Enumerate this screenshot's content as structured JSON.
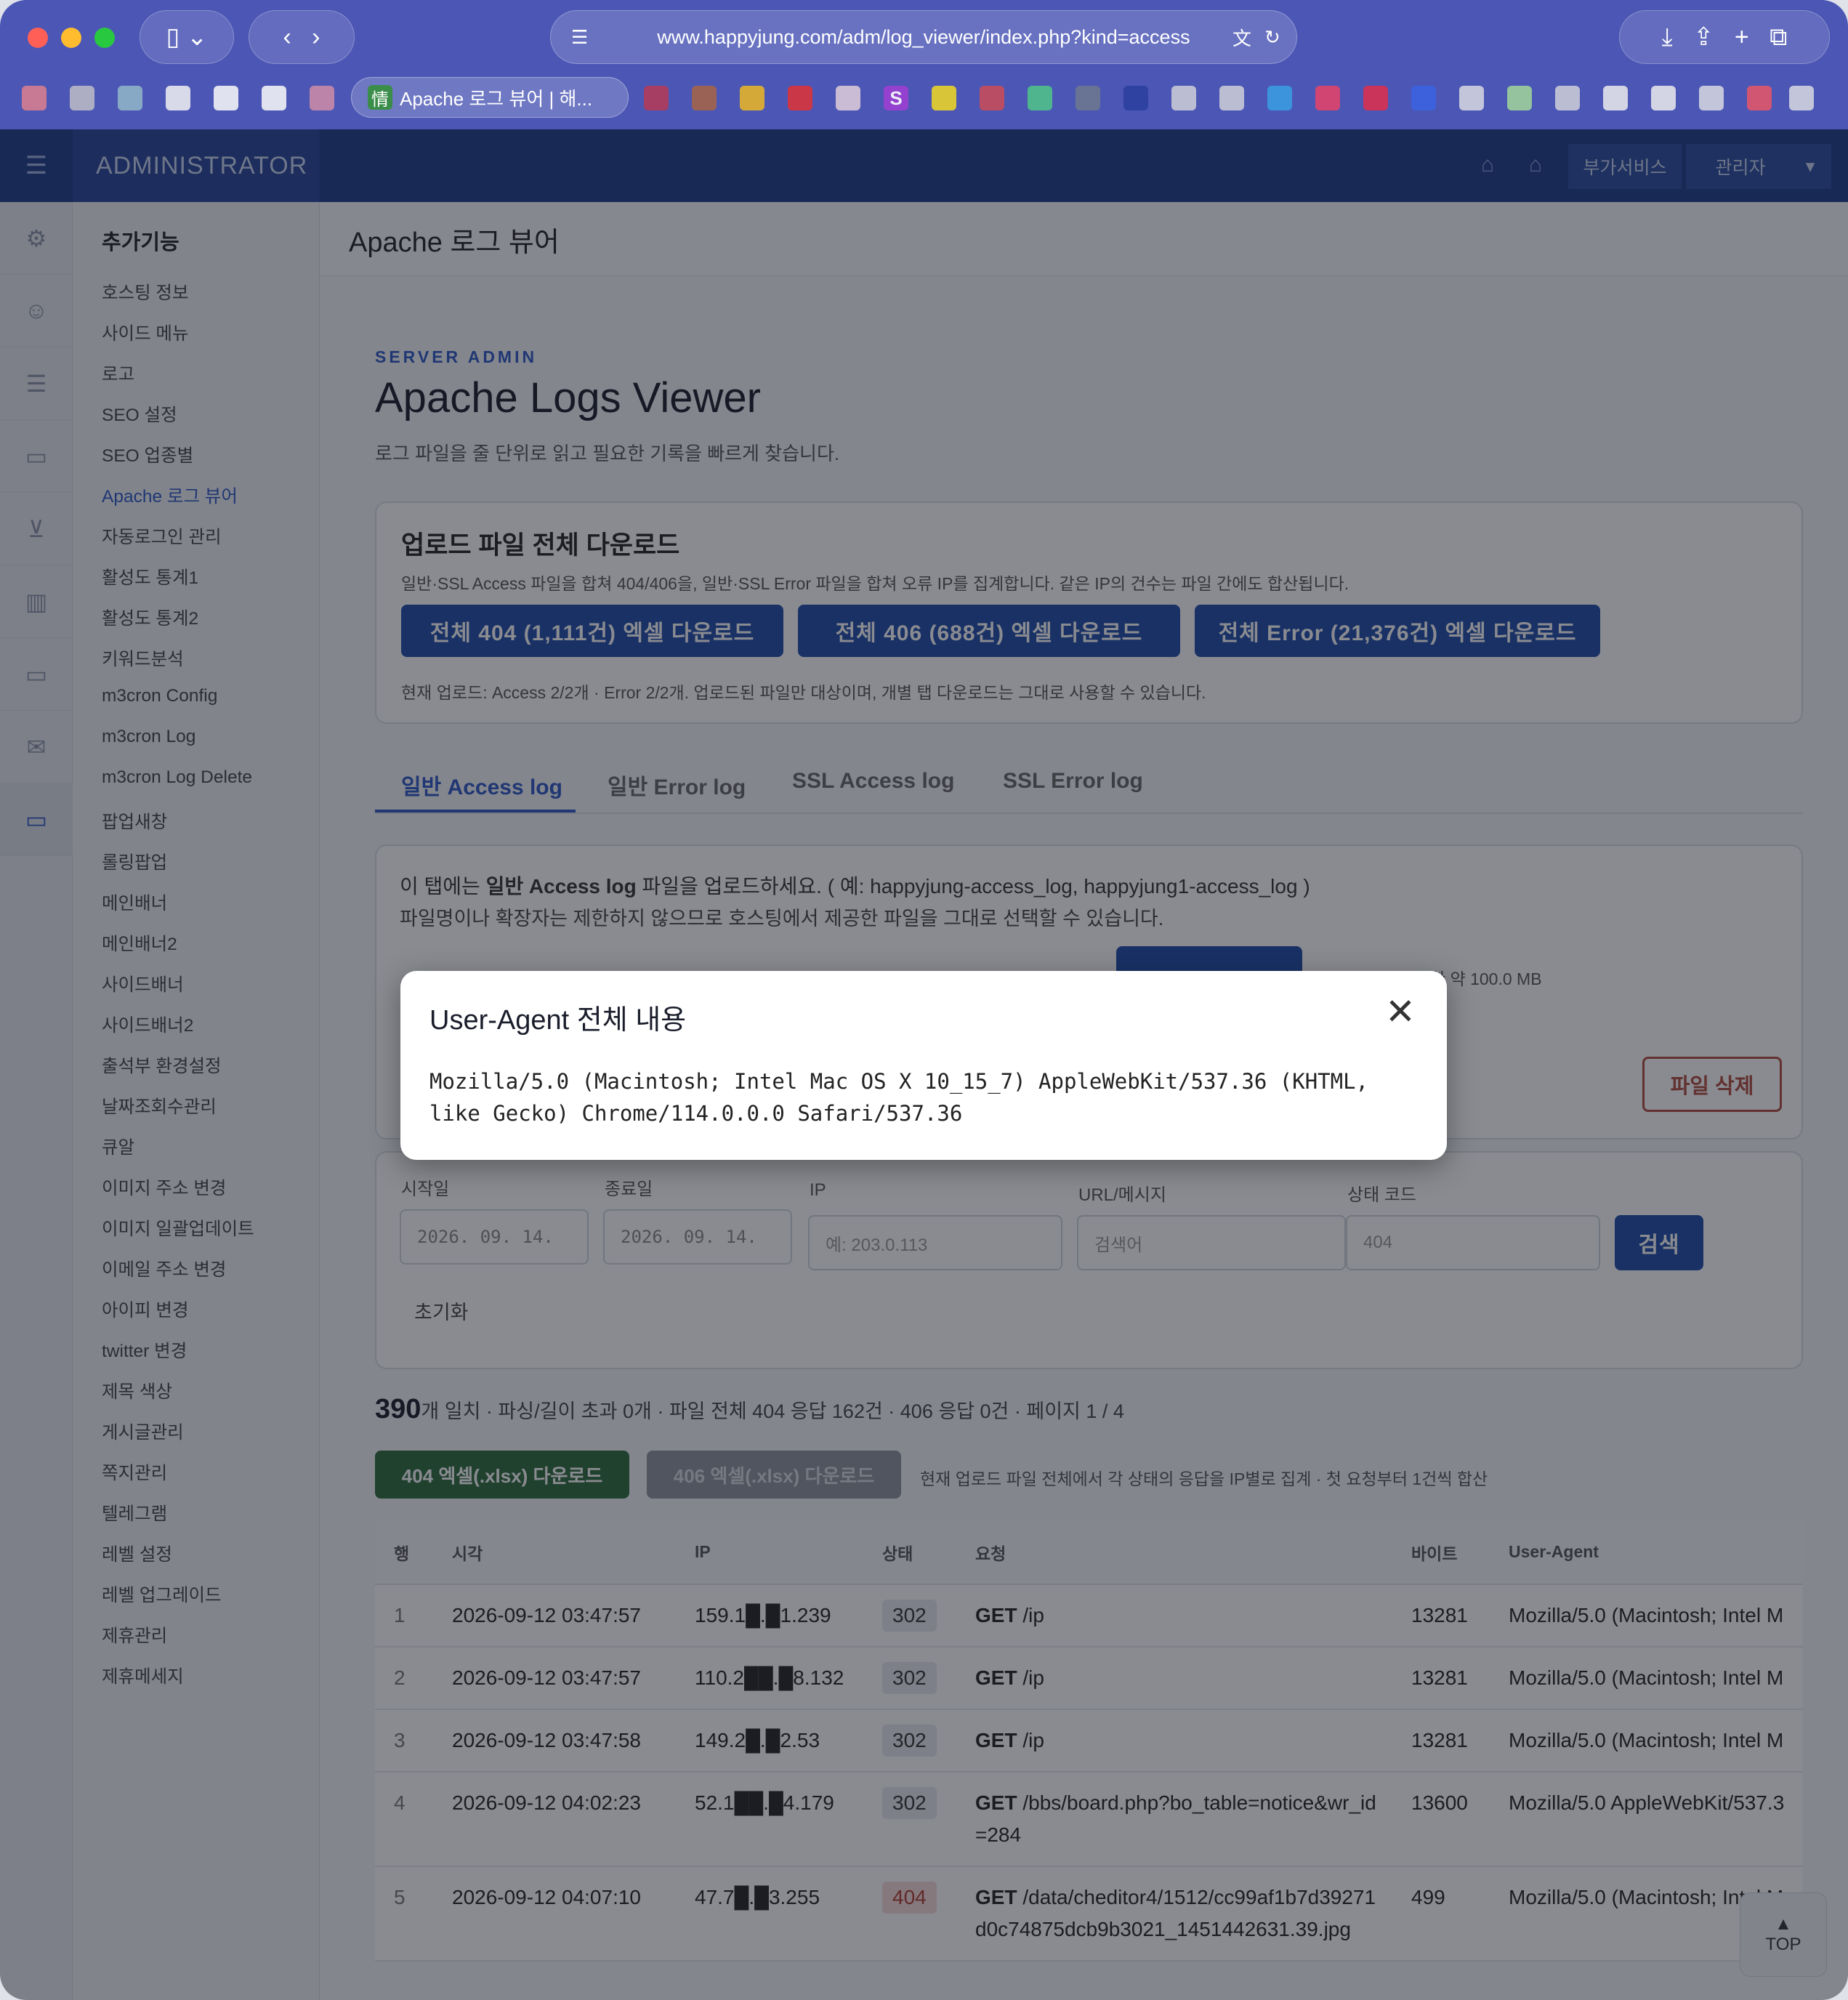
{
  "browser": {
    "url": "www.happyjung.com/adm/log_viewer/index.php?kind=access",
    "active_tab": "Apache 로그 뷰어 | 해...",
    "active_tab_icon": "情"
  },
  "header": {
    "brand": "ADMINISTRATOR",
    "extra_services": "부가서비스",
    "admin": "관리자"
  },
  "sidebar": {
    "title": "추가기능",
    "items": [
      "호스팅 정보",
      "사이드 메뉴",
      "로고",
      "SEO 설정",
      "SEO 업종별",
      "Apache 로그 뷰어",
      "자동로그인 관리",
      "활성도 통계1",
      "활성도 통계2",
      "키워드분석",
      "m3cron Config",
      "m3cron Log",
      "m3cron Log Delete",
      "팝업새창",
      "롤링팝업",
      "메인배너",
      "메인배너2",
      "사이드배너",
      "사이드배너2",
      "출석부 환경설정",
      "날짜조회수관리",
      "큐알",
      "이미지 주소 변경",
      "이미지 일괄업데이트",
      "이메일 주소 변경",
      "아이피 변경",
      "twitter 변경",
      "제목 색상",
      "게시글관리",
      "쪽지관리",
      "텔레그램",
      "레벨 설정",
      "레벨 업그레이드",
      "제휴관리",
      "제휴메세지"
    ],
    "active_index": 5
  },
  "page": {
    "breadcrumb": "Apache 로그 뷰어",
    "eyebrow": "SERVER ADMIN",
    "title": "Apache Logs Viewer",
    "lead": "로그 파일을 줄 단위로 읽고 필요한 기록을 빠르게 찾습니다."
  },
  "download_card": {
    "title": "업로드 파일 전체 다운로드",
    "desc": "일반·SSL Access 파일을 합쳐 404/406을, 일반·SSL Error 파일을 합쳐 오류 IP를 집계합니다. 같은 IP의 건수는 파일 간에도 합산됩니다.",
    "btn_404": "전체 404 (1,111건) 엑셀 다운로드",
    "btn_406": "전체 406 (688건) 엑셀 다운로드",
    "btn_error": "전체 Error (21,376건) 엑셀 다운로드",
    "note": "현재 업로드: Access 2/2개 · Error 2/2개. 업로드된 파일만 대상이며, 개별 탭 다운로드는 그대로 사용할 수 있습니다."
  },
  "tabs": [
    "일반 Access log",
    "일반 Error log",
    "SSL Access log",
    "SSL Error log"
  ],
  "upload": {
    "line1_prefix": "이 탭에는 ",
    "line1_bold": "일반 Access log",
    "line1_suffix": " 파일을 업로드하세요. ( 예: happyjung-access_log, happyjung1-access_log )",
    "line2": "파일명이나 확장자는 제한하지 않으므로 호스팅에서 제공한 파일을 그대로 선택할 수 있습니다.",
    "limit": "한 약 100.0 MB",
    "delete_btn": "파일 삭제"
  },
  "filters": {
    "start_label": "시작일",
    "start_value": "2026. 09. 14.",
    "end_label": "종료일",
    "end_value": "2026. 09. 14.",
    "ip_label": "IP",
    "ip_placeholder": "예: 203.0.113",
    "url_label": "URL/메시지",
    "url_placeholder": "검색어",
    "status_label": "상태 코드",
    "status_placeholder": "404",
    "search_btn": "검색",
    "reset": "초기화"
  },
  "summary": {
    "count": "390",
    "text": "개 일치 · 파싱/길이 초과 0개 · 파일 전체 404 응답 162건 · 406 응답 0건 · 페이지 1 / 4"
  },
  "excel": {
    "btn_404": "404 엑셀(.xlsx) 다운로드",
    "btn_406": "406 엑셀(.xlsx) 다운로드",
    "note": "현재 업로드 파일 전체에서 각 상태의 응답을 IP별로 집계 · 첫 요청부터 1건씩 합산"
  },
  "table": {
    "headers": [
      "행",
      "시각",
      "IP",
      "상태",
      "요청",
      "바이트",
      "User-Agent"
    ],
    "rows": [
      {
        "n": "1",
        "time": "2026-09-12 03:47:57",
        "ip": "159.1█.█1.239",
        "status": "302",
        "method": "GET",
        "path": "/ip",
        "bytes": "13281",
        "ua": "Mozilla/5.0 (Macintosh; Intel M"
      },
      {
        "n": "2",
        "time": "2026-09-12 03:47:57",
        "ip": "110.2██.█8.132",
        "status": "302",
        "method": "GET",
        "path": "/ip",
        "bytes": "13281",
        "ua": "Mozilla/5.0 (Macintosh; Intel M"
      },
      {
        "n": "3",
        "time": "2026-09-12 03:47:58",
        "ip": "149.2█.█2.53",
        "status": "302",
        "method": "GET",
        "path": "/ip",
        "bytes": "13281",
        "ua": "Mozilla/5.0 (Macintosh; Intel M"
      },
      {
        "n": "4",
        "time": "2026-09-12 04:02:23",
        "ip": "52.1██.█4.179",
        "status": "302",
        "method": "GET",
        "path": "/bbs/board.php?bo_table=notice&wr_id=284",
        "bytes": "13600",
        "ua": "Mozilla/5.0 AppleWebKit/537.3"
      },
      {
        "n": "5",
        "time": "2026-09-12 04:07:10",
        "ip": "47.7█.█3.255",
        "status": "404",
        "method": "GET",
        "path": "/data/cheditor4/1512/cc99af1b7d39271d0c74875dcb9b3021_1451442631.39.jpg",
        "bytes": "499",
        "ua": "Mozilla/5.0 (Macintosh; Intel M"
      }
    ]
  },
  "top_btn": "TOP",
  "modal": {
    "title": "User-Agent 전체 내용",
    "body": "Mozilla/5.0 (Macintosh; Intel Mac OS X 10_15_7) AppleWebKit/537.36 (KHTML, like Gecko) Chrome/114.0.0.0 Safari/537.36"
  },
  "colors": {
    "primary": "#1f4aa8",
    "topbar": "#1d3a8a",
    "chrome": "#4c57b5",
    "success": "#2e6b3c",
    "danger": "#b14a3e"
  }
}
